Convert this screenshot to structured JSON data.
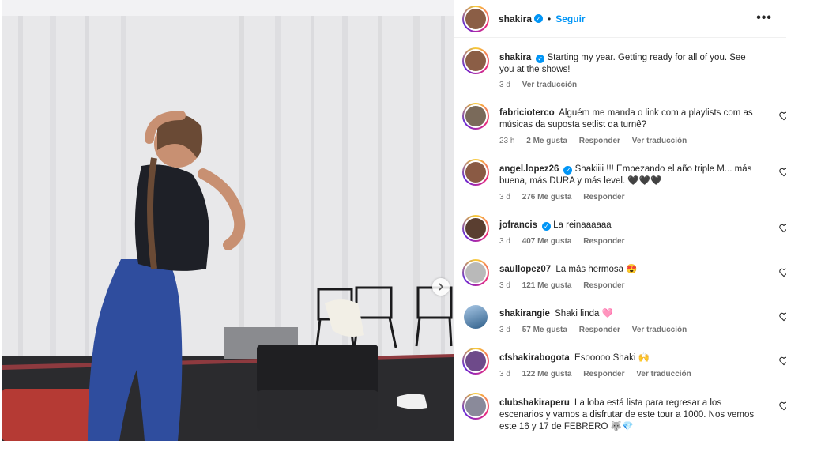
{
  "post": {
    "username": "shakira",
    "dot": "•",
    "follow_label": "Seguir",
    "more_label": "•••",
    "caption": "Starting my year. Getting ready for all of you. See you at the shows!",
    "caption_time": "3 d",
    "caption_translate": "Ver traducción"
  },
  "comments": [
    {
      "user": "fabricioterco",
      "verified": false,
      "text": "Alguém me manda o link com a playlists com as músicas da suposta setlist da turnê?",
      "time": "23 h",
      "likes": "2 Me gusta",
      "reply": "Responder",
      "translate": "Ver traducción",
      "avatar_color": "#7a6a5a"
    },
    {
      "user": "angel.lopez26",
      "verified": true,
      "text": "Shakiiii !!! Empezando el año triple M... más buena, más DURA y más level. 🖤🖤🖤",
      "time": "3 d",
      "likes": "276 Me gusta",
      "reply": "Responder",
      "translate": "",
      "avatar_color": "#8a5a44"
    },
    {
      "user": "jofrancis",
      "verified": true,
      "text": "La reinaaaaaa",
      "time": "3 d",
      "likes": "407 Me gusta",
      "reply": "Responder",
      "translate": "",
      "avatar_color": "#5a3e30"
    },
    {
      "user": "saullopez07",
      "verified": false,
      "text": "La más hermosa 😍",
      "time": "3 d",
      "likes": "121 Me gusta",
      "reply": "Responder",
      "translate": "",
      "avatar_color": "#b9b9b9"
    },
    {
      "user": "shakirangie",
      "verified": false,
      "text": "Shaki linda 🩷",
      "time": "3 d",
      "likes": "57 Me gusta",
      "reply": "Responder",
      "translate": "Ver traducción",
      "avatar_color": "#5f8fb8"
    },
    {
      "user": "cfshakirabogota",
      "verified": false,
      "text": "Esooooo Shaki 🙌",
      "time": "3 d",
      "likes": "122 Me gusta",
      "reply": "Responder",
      "translate": "Ver traducción",
      "avatar_color": "#6e4a8a"
    },
    {
      "user": "clubshakiraperu",
      "verified": false,
      "text": "La loba está lista para regresar a los escenarios y vamos a disfrutar de este tour a 1000. Nos vemos este 16 y 17 de FEBRERO 🐺💎",
      "time": "",
      "likes": "",
      "reply": "",
      "translate": "",
      "avatar_color": "#8a8a9a"
    }
  ],
  "colors": {
    "accent": "#0095f6",
    "text": "#262626",
    "muted": "#737373",
    "ring_start": "#f9ce34",
    "ring_mid": "#ee2a7b",
    "ring_end": "#6228d7"
  },
  "icons": {
    "verified": "verified-badge-icon",
    "heart": "heart-outline-icon",
    "more": "more-options-icon",
    "next": "chevron-right-icon"
  }
}
